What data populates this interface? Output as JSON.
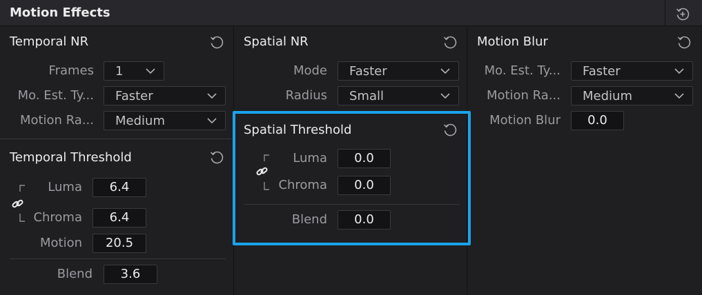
{
  "header": {
    "title": "Motion Effects",
    "icon": "reset-all-icon"
  },
  "temporal_nr": {
    "title": "Temporal NR",
    "rows": [
      {
        "label": "Frames",
        "value": "1"
      },
      {
        "label": "Mo. Est. Ty...",
        "value": "Faster"
      },
      {
        "label": "Motion Ra...",
        "value": "Medium"
      }
    ]
  },
  "temporal_threshold": {
    "title": "Temporal Threshold",
    "luma_label": "Luma",
    "luma": "6.4",
    "chroma_label": "Chroma",
    "chroma": "6.4",
    "motion_label": "Motion",
    "motion": "20.5",
    "blend_label": "Blend",
    "blend": "3.6"
  },
  "spatial_nr": {
    "title": "Spatial NR",
    "rows": [
      {
        "label": "Mode",
        "value": "Faster"
      },
      {
        "label": "Radius",
        "value": "Small"
      }
    ]
  },
  "spatial_threshold": {
    "title": "Spatial Threshold",
    "luma_label": "Luma",
    "luma": "0.0",
    "chroma_label": "Chroma",
    "chroma": "0.0",
    "blend_label": "Blend",
    "blend": "0.0"
  },
  "motion_blur": {
    "title": "Motion Blur",
    "rows": [
      {
        "label": "Mo. Est. Ty...",
        "value": "Faster"
      },
      {
        "label": "Motion Ra...",
        "value": "Medium"
      }
    ],
    "blur_label": "Motion Blur",
    "blur": "0.0"
  },
  "colors": {
    "accent": "#1aa3ea",
    "background": "#1f1f22"
  }
}
